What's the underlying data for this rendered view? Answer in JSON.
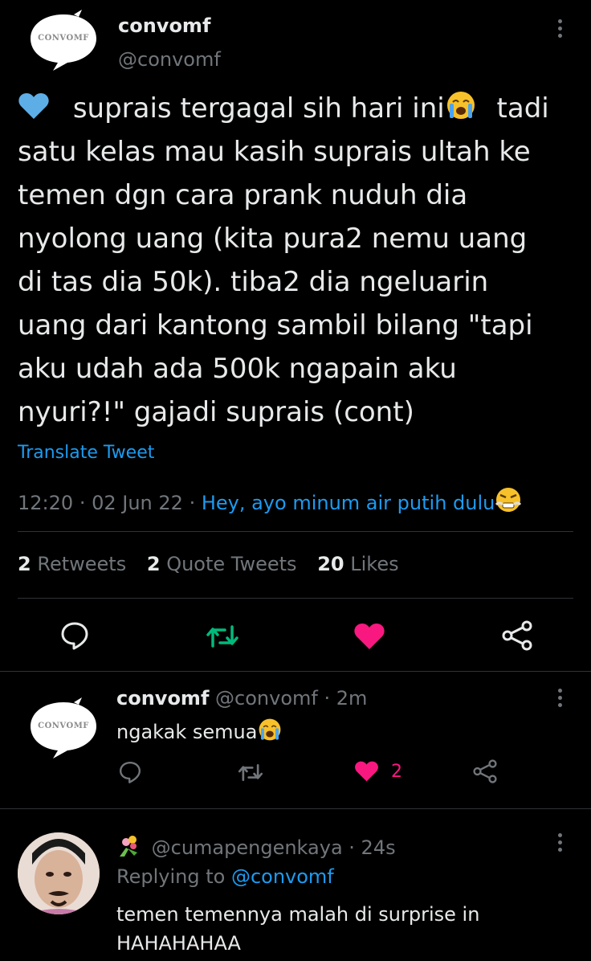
{
  "main_tweet": {
    "author_name": "convomf",
    "author_handle": "@convomf",
    "avatar_text": "CONVOMF",
    "text_lines": [
      "suprais tergagal sih hari ini",
      "tadi",
      "satu kelas mau kasih suprais ultah ke",
      "temen dgn cara prank nuduh dia",
      "nyolong uang (kita pura2 nemu uang",
      "di tas dia 50k). tiba2 dia ngeluarin",
      "uang dari kantong sambil bilang \"tapi",
      "aku udah ada 500k ngapain aku",
      "nyuri?!\" gajadi suprais (cont)"
    ],
    "translate_label": "Translate Tweet",
    "time": "12:20",
    "date": "02 Jun 22",
    "source": "Hey, ayo minum air putih dulu",
    "stats": {
      "retweets_count": "2",
      "retweets_label": "Retweets",
      "quotes_count": "2",
      "quotes_label": "Quote Tweets",
      "likes_count": "20",
      "likes_label": "Likes"
    }
  },
  "replies": [
    {
      "author_name": "convomf",
      "author_handle": "@convomf",
      "time": "· 2m",
      "avatar_text": "CONVOMF",
      "text": "ngakak semua",
      "like_count": "2"
    },
    {
      "author_handle": "@cumapengenkaya",
      "time": "· 24s",
      "replying_label": "Replying to",
      "replying_to": "@convomf",
      "text_lines": [
        "temen temennya malah di surprise in",
        "HAHAHAHAA"
      ]
    }
  ],
  "colors": {
    "background": "#000000",
    "text": "#e7e9ea",
    "muted": "#71767b",
    "accent_blue": "#1d9bf0",
    "retweet_green": "#00ba7c",
    "like_pink": "#f91880",
    "heart_emoji": "#5daee7"
  },
  "icons": [
    "heart-emoji-icon",
    "crying-face-icon",
    "angry-face-icon",
    "reply-icon",
    "retweet-icon",
    "like-icon",
    "share-icon",
    "more-icon",
    "bouquet-icon"
  ]
}
